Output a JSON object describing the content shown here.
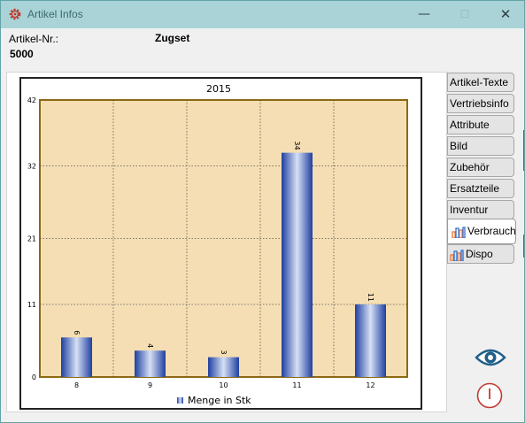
{
  "window": {
    "title": "Artikel Infos",
    "controls": {
      "minimize": "—",
      "maximize": "☐",
      "close": "✕"
    }
  },
  "header": {
    "article_nr_label": "Artikel-Nr.:",
    "article_name": "Zugset",
    "article_nr": "5000"
  },
  "tabs": [
    {
      "label": "Artikel-Texte",
      "active": false,
      "icon": null
    },
    {
      "label": "Vertriebsinfo",
      "active": false,
      "icon": null
    },
    {
      "label": "Attribute",
      "active": false,
      "icon": null
    },
    {
      "label": "Bild",
      "active": false,
      "icon": null
    },
    {
      "label": "Zubehör",
      "active": false,
      "icon": null
    },
    {
      "label": "Ersatzteile",
      "active": false,
      "icon": null
    },
    {
      "label": "Inventur",
      "active": false,
      "icon": null
    },
    {
      "label": "Verbrauch",
      "active": true,
      "icon": "bar-chart-icon"
    },
    {
      "label": "Dispo",
      "active": false,
      "icon": "bar-chart-icon"
    }
  ],
  "actions": {
    "view_icon": "eye-icon",
    "exit_icon": "power-icon"
  },
  "colors": {
    "titlebar": "#a9d3d7",
    "plot_background": "#f5deb3",
    "plot_border": "#8b6914",
    "bar_dark": "#1f3fa0",
    "bar_light": "#d6e0f5",
    "accent_red": "#c23a33"
  },
  "chart_data": {
    "type": "bar",
    "title": "2015",
    "categories": [
      "8",
      "9",
      "10",
      "11",
      "12"
    ],
    "series": [
      {
        "name": "Menge in Stk",
        "values": [
          6,
          4,
          3,
          34,
          11
        ]
      }
    ],
    "data_labels": [
      "6",
      "4",
      "3",
      "34",
      "11"
    ],
    "y_ticks": [
      0,
      11,
      21,
      32,
      42
    ],
    "ylim": [
      0,
      42
    ],
    "grid": true,
    "legend_position": "bottom",
    "xlabel": "",
    "ylabel": ""
  }
}
